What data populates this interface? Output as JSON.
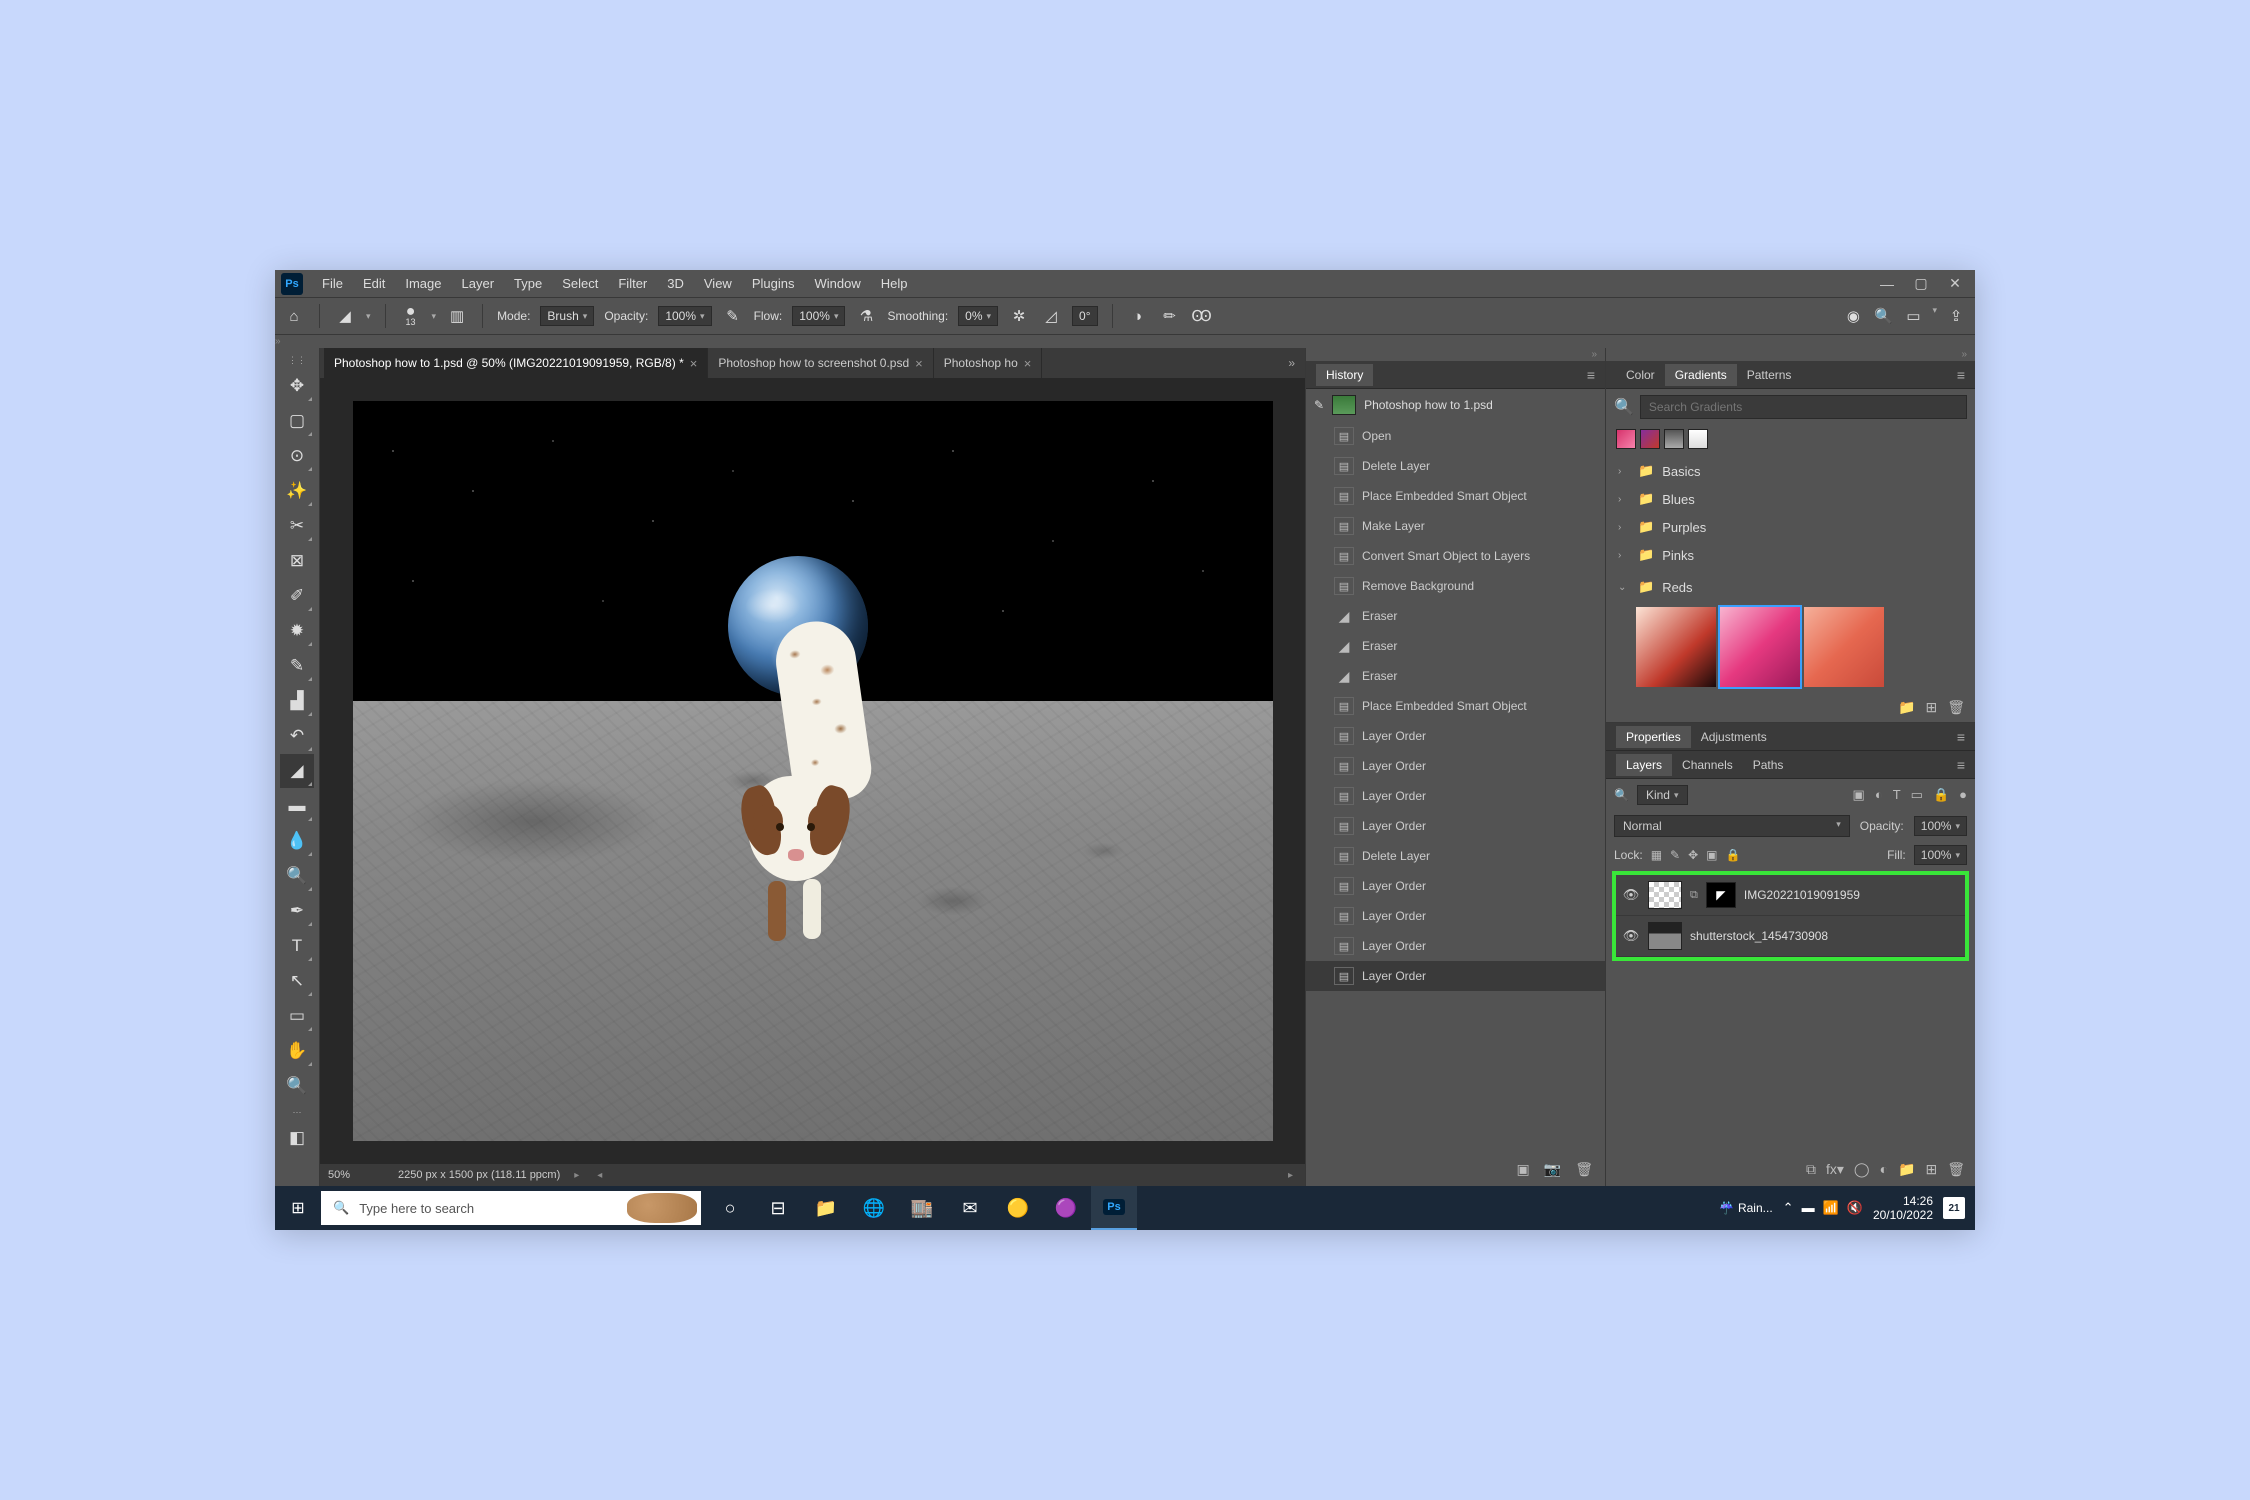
{
  "menu": [
    "File",
    "Edit",
    "Image",
    "Layer",
    "Type",
    "Select",
    "Filter",
    "3D",
    "View",
    "Plugins",
    "Window",
    "Help"
  ],
  "options": {
    "mode_label": "Mode:",
    "mode": "Brush",
    "opacity_label": "Opacity:",
    "opacity": "100%",
    "flow_label": "Flow:",
    "flow": "100%",
    "smoothing_label": "Smoothing:",
    "smoothing": "0%",
    "angle": "0°",
    "brush_size": "13"
  },
  "tabs": [
    {
      "label": "Photoshop how to 1.psd @ 50% (IMG20221019091959, RGB/8) *",
      "active": true
    },
    {
      "label": "Photoshop how to screenshot 0.psd",
      "active": false
    },
    {
      "label": "Photoshop ho",
      "active": false
    }
  ],
  "status": {
    "zoom": "50%",
    "dims": "2250 px x 1500 px (118.11 ppcm)"
  },
  "history": {
    "title": "History",
    "doc": "Photoshop how to 1.psd",
    "items": [
      {
        "icon": "doc",
        "label": "Open"
      },
      {
        "icon": "doc",
        "label": "Delete Layer"
      },
      {
        "icon": "doc",
        "label": "Place Embedded Smart Object"
      },
      {
        "icon": "doc",
        "label": "Make Layer"
      },
      {
        "icon": "doc",
        "label": "Convert Smart Object to Layers"
      },
      {
        "icon": "doc",
        "label": "Remove Background"
      },
      {
        "icon": "eraser",
        "label": "Eraser"
      },
      {
        "icon": "eraser",
        "label": "Eraser"
      },
      {
        "icon": "eraser",
        "label": "Eraser"
      },
      {
        "icon": "doc",
        "label": "Place Embedded Smart Object"
      },
      {
        "icon": "doc",
        "label": "Layer Order"
      },
      {
        "icon": "doc",
        "label": "Layer Order"
      },
      {
        "icon": "doc",
        "label": "Layer Order"
      },
      {
        "icon": "doc",
        "label": "Layer Order"
      },
      {
        "icon": "doc",
        "label": "Delete Layer"
      },
      {
        "icon": "doc",
        "label": "Layer Order"
      },
      {
        "icon": "doc",
        "label": "Layer Order"
      },
      {
        "icon": "doc",
        "label": "Layer Order"
      },
      {
        "icon": "doc",
        "label": "Layer Order",
        "sel": true
      }
    ]
  },
  "color_tabs": [
    "Color",
    "Gradients",
    "Patterns"
  ],
  "gradients": {
    "search_placeholder": "Search Gradients",
    "folders": [
      "Basics",
      "Blues",
      "Purples",
      "Pinks"
    ],
    "open_folder": "Reds"
  },
  "prop_tabs": [
    "Properties",
    "Adjustments"
  ],
  "layer_tabs": [
    "Layers",
    "Channels",
    "Paths"
  ],
  "layers": {
    "kind": "Kind",
    "mode": "Normal",
    "opacity_label": "Opacity:",
    "opacity": "100%",
    "lock_label": "Lock:",
    "fill_label": "Fill:",
    "fill": "100%",
    "items": [
      {
        "name": "IMG20221019091959",
        "mask": true
      },
      {
        "name": "shutterstock_1454730908",
        "mask": false
      }
    ]
  },
  "taskbar": {
    "search_placeholder": "Type here to search",
    "weather": "Rain...",
    "time": "14:26",
    "date": "20/10/2022",
    "notif": "21"
  }
}
